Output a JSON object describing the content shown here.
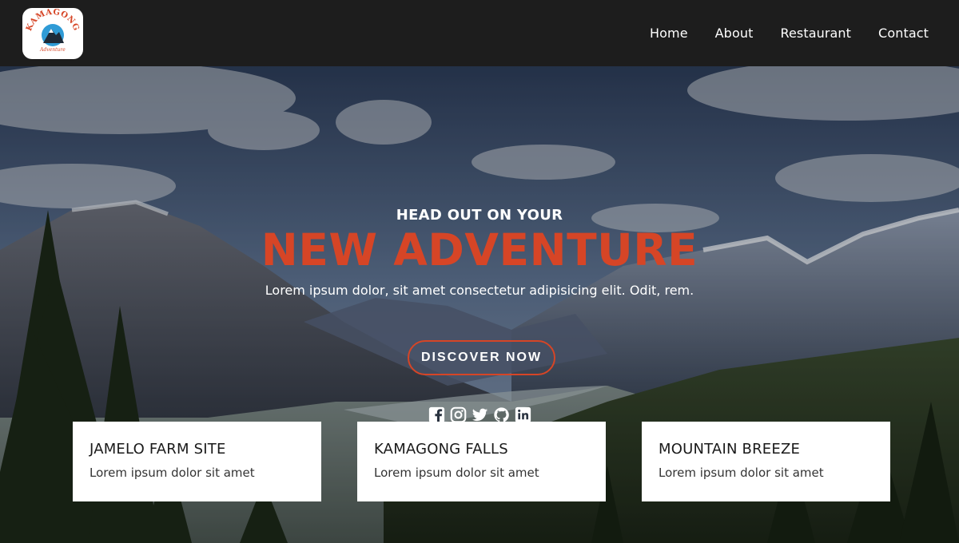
{
  "brand": {
    "logo_text": "KAMAGONG",
    "logo_subtext": "Adventure"
  },
  "nav": {
    "items": [
      {
        "label": "Home"
      },
      {
        "label": "About"
      },
      {
        "label": "Restaurant"
      },
      {
        "label": "Contact"
      }
    ]
  },
  "hero": {
    "subtitle": "HEAD OUT ON YOUR",
    "title": "NEW ADVENTURE",
    "description": "Lorem ipsum dolor, sit amet consectetur adipisicing elit. Odit, rem.",
    "cta_label": "DISCOVER NOW",
    "social_icons": [
      "facebook-icon",
      "instagram-icon",
      "twitter-icon",
      "github-icon",
      "linkedin-icon"
    ]
  },
  "cards": [
    {
      "title": "JAMELO FARM SITE",
      "text": "Lorem ipsum dolor sit amet"
    },
    {
      "title": "KAMAGONG FALLS",
      "text": "Lorem ipsum dolor sit amet"
    },
    {
      "title": "MOUNTAIN BREEZE",
      "text": "Lorem ipsum dolor sit amet"
    }
  ],
  "colors": {
    "navbar_bg": "#1d1d1d",
    "accent": "#d64526",
    "text_light": "#ffffff",
    "card_bg": "#ffffff"
  }
}
